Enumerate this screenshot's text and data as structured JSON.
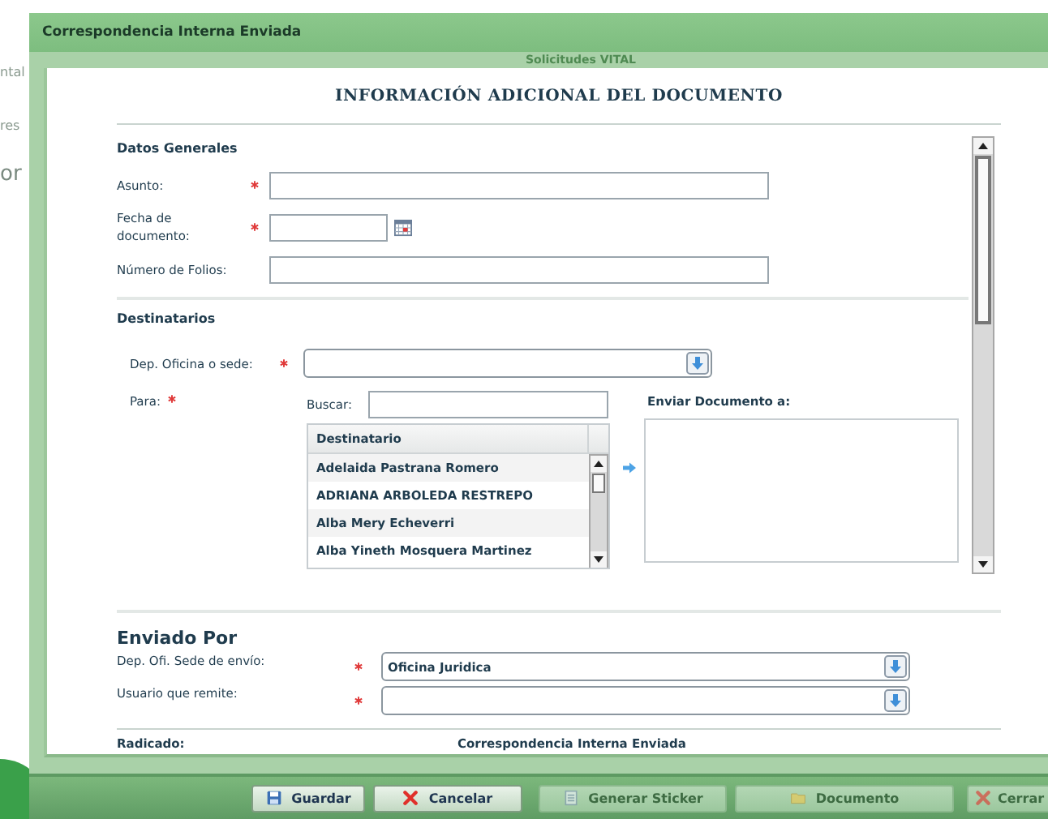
{
  "background": {
    "window_title": "Correspondencia Interna Enviada",
    "header": "Solicitudes VITAL",
    "fragments": [
      "ntal",
      "res",
      "or"
    ]
  },
  "dialog": {
    "title": "INFORMACIÓN ADICIONAL DEL DOCUMENTO",
    "general": {
      "heading": "Datos Generales",
      "fields": [
        {
          "kind": "text",
          "label": "Asunto:",
          "required": true
        },
        {
          "kind": "date",
          "label": "Fecha de documento:",
          "required": true
        },
        {
          "kind": "text",
          "label": "Número de Folios:",
          "required": false
        }
      ]
    },
    "recipients": {
      "heading": "Destinatarios",
      "office": {
        "label": "Dep. Oficina o sede:",
        "required": true
      },
      "to": {
        "label": "Para:",
        "required": true
      },
      "search_label": "Buscar:",
      "table_header": "Destinatario",
      "rows": [
        {
          "name": "Adelaida Pastrana Romero"
        },
        {
          "name": "ADRIANA ARBOLEDA RESTREPO"
        },
        {
          "name": "Alba Mery Echeverri"
        },
        {
          "name": "Alba Yineth Mosquera Martinez"
        }
      ],
      "send_to_label": "Enviar Documento a:"
    },
    "sender": {
      "heading": "Enviado Por",
      "fields": [
        {
          "label": "Dep. Ofi. Sede de envío:",
          "value": "Oficina Juridica",
          "required": true
        },
        {
          "label": "Usuario que remite:",
          "required": true
        }
      ]
    },
    "footer": {
      "label": "Radicado:",
      "value": "Correspondencia Interna Enviada"
    }
  },
  "toolbar": [
    {
      "label": "Guardar",
      "disabled": false
    },
    {
      "label": "Cancelar",
      "disabled": false
    },
    {
      "label": "Generar Sticker",
      "disabled": true
    },
    {
      "label": "Documento",
      "disabled": true
    },
    {
      "label": "Cerrar",
      "disabled": true
    }
  ]
}
